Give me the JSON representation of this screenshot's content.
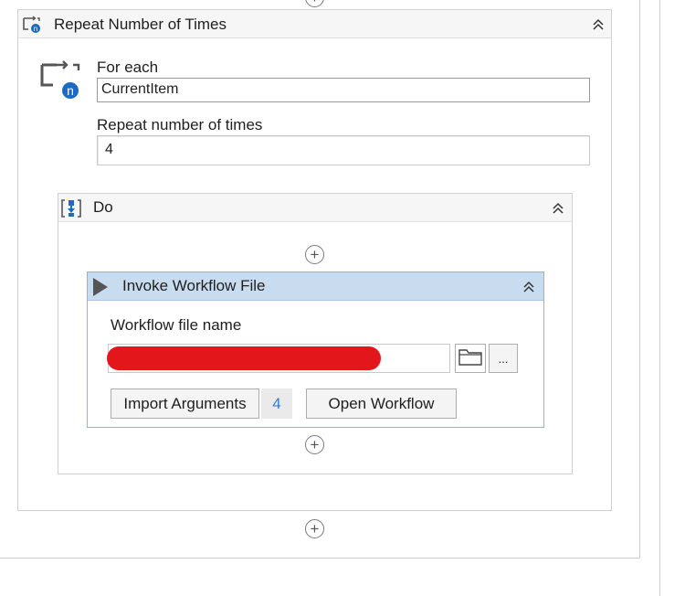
{
  "repeat_activity": {
    "title": "Repeat Number of Times",
    "icon": "repeat-n-icon",
    "collapse_icon": "double-chevron-up-icon",
    "for_each_label": "For each",
    "for_each_value": "CurrentItem",
    "repeat_label": "Repeat number of times",
    "repeat_value": "4",
    "iterator_icon": "iterator-n-icon"
  },
  "do_sequence": {
    "title": "Do",
    "icon": "sequence-icon",
    "collapse_icon": "double-chevron-up-icon",
    "add_icon": "plus-circle-icon"
  },
  "invoke_activity": {
    "title": "Invoke Workflow File",
    "icon": "play-triangle-icon",
    "collapse_icon": "double-chevron-up-icon",
    "file_label": "Workflow file name",
    "browse_icon": "folder-icon",
    "more_label": "...",
    "import_label": "Import Arguments",
    "import_count": "4",
    "open_label": "Open Workflow"
  },
  "colors": {
    "header_gray": "#f6f6f6",
    "invoke_header": "#c9dbee",
    "accent_blue": "#1b6ac4",
    "redaction_red": "#e3161b"
  }
}
